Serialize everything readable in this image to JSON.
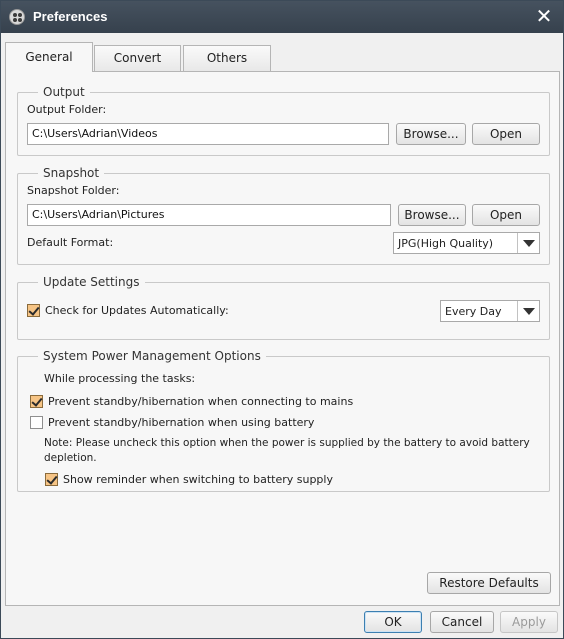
{
  "window": {
    "title": "Preferences"
  },
  "tabs": [
    {
      "label": "General",
      "active": true
    },
    {
      "label": "Convert",
      "active": false
    },
    {
      "label": "Others",
      "active": false
    }
  ],
  "output": {
    "legend": "Output",
    "folder_label": "Output Folder:",
    "folder_value": "C:\\Users\\Adrian\\Videos",
    "browse_label": "Browse...",
    "open_label": "Open"
  },
  "snapshot": {
    "legend": "Snapshot",
    "folder_label": "Snapshot Folder:",
    "folder_value": "C:\\Users\\Adrian\\Pictures",
    "browse_label": "Browse...",
    "open_label": "Open",
    "format_label": "Default Format:",
    "format_value": "JPG(High Quality)"
  },
  "update": {
    "legend": "Update Settings",
    "check_label": "Check for Updates Automatically:",
    "check_checked": true,
    "frequency_value": "Every Day"
  },
  "power": {
    "legend": "System Power Management Options",
    "intro": "While processing the tasks:",
    "mains_label": "Prevent standby/hibernation when connecting to mains",
    "mains_checked": true,
    "battery_label": "Prevent standby/hibernation when using battery",
    "battery_checked": false,
    "note_line1": "Note: Please uncheck this option when the power is supplied by the battery to avoid battery",
    "note_line2": "depletion.",
    "reminder_label": "Show reminder when switching to battery supply",
    "reminder_checked": true
  },
  "footer": {
    "restore_label": "Restore Defaults",
    "ok_label": "OK",
    "cancel_label": "Cancel",
    "apply_label": "Apply"
  },
  "colors": {
    "titlebar": "#3f4a56",
    "checkbox_checked": "#f6c485",
    "primary_button_border": "#3c7fb1"
  }
}
